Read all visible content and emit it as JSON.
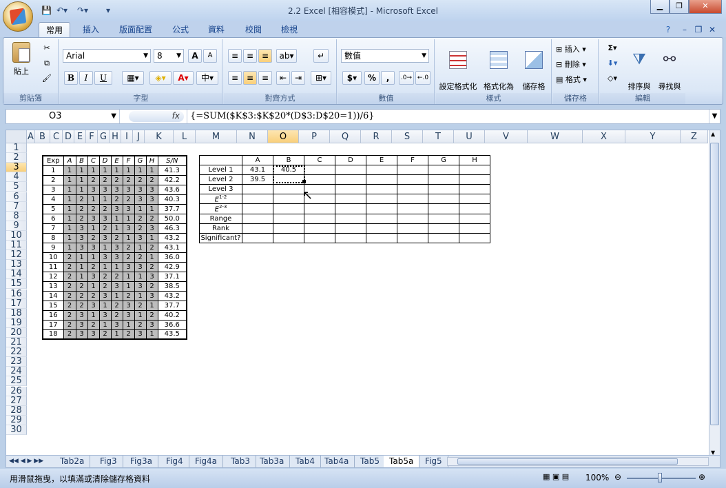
{
  "window": {
    "title": "2.2 Excel  [相容模式] - Microsoft Excel"
  },
  "ribbon_tabs": [
    "常用",
    "插入",
    "版面配置",
    "公式",
    "資料",
    "校閱",
    "檢視"
  ],
  "clipboard": {
    "paste": "貼上",
    "label": "剪貼簿"
  },
  "font": {
    "name": "Arial",
    "size": "8",
    "label": "字型",
    "bold": "B",
    "italic": "I",
    "underline": "U",
    "grow": "A",
    "shrink": "A",
    "color_char": "A"
  },
  "align": {
    "label": "對齊方式"
  },
  "number": {
    "format": "數值",
    "label": "數值",
    "currency": "$",
    "percent": "%",
    "comma": ","
  },
  "styles": {
    "cond": "設定格式化\n的條件",
    "table": "格式化為\n表格",
    "cell": "儲存格\n樣式",
    "label": "樣式"
  },
  "cells": {
    "insert": "插入",
    "delete": "刪除",
    "format": "格式",
    "label": "儲存格"
  },
  "editing": {
    "sort": "排序與\n篩選",
    "find": "尋找與\n選取",
    "label": "編輯",
    "sigma": "Σ"
  },
  "namebox": "O3",
  "fx": "fx",
  "formula": "{=SUM($K$3:$K$20*(D$3:D$20=1))/6}",
  "columns": [
    "A",
    "B",
    "C",
    "D",
    "E",
    "F",
    "G",
    "H",
    "I",
    "J",
    "K",
    "L",
    "M",
    "N",
    "O",
    "P",
    "Q",
    "R",
    "S",
    "T",
    "U",
    "V",
    "W",
    "X",
    "Y",
    "Z"
  ],
  "rows": [
    "1",
    "2",
    "3",
    "4",
    "5",
    "6",
    "7",
    "8",
    "9",
    "10",
    "11",
    "12",
    "13",
    "14",
    "15",
    "16",
    "17",
    "18",
    "19",
    "20",
    "21",
    "22",
    "23",
    "24",
    "25",
    "26",
    "27",
    "28",
    "29",
    "30"
  ],
  "table1": {
    "header": [
      "Exp",
      "A",
      "B",
      "C",
      "D",
      "E",
      "F",
      "G",
      "H",
      "S/N"
    ],
    "rows": [
      [
        "1",
        "1",
        "1",
        "1",
        "1",
        "1",
        "1",
        "1",
        "1",
        "41.3"
      ],
      [
        "2",
        "1",
        "1",
        "2",
        "2",
        "2",
        "2",
        "2",
        "2",
        "42.2"
      ],
      [
        "3",
        "1",
        "1",
        "3",
        "3",
        "3",
        "3",
        "3",
        "3",
        "43.6"
      ],
      [
        "4",
        "1",
        "2",
        "1",
        "1",
        "2",
        "2",
        "3",
        "3",
        "40.3"
      ],
      [
        "5",
        "1",
        "2",
        "2",
        "2",
        "3",
        "3",
        "1",
        "1",
        "37.7"
      ],
      [
        "6",
        "1",
        "2",
        "3",
        "3",
        "1",
        "1",
        "2",
        "2",
        "50.0"
      ],
      [
        "7",
        "1",
        "3",
        "1",
        "2",
        "1",
        "3",
        "2",
        "3",
        "46.3"
      ],
      [
        "8",
        "1",
        "3",
        "2",
        "3",
        "2",
        "1",
        "3",
        "1",
        "43.2"
      ],
      [
        "9",
        "1",
        "3",
        "3",
        "1",
        "3",
        "2",
        "1",
        "2",
        "43.1"
      ],
      [
        "10",
        "2",
        "1",
        "1",
        "3",
        "3",
        "2",
        "2",
        "1",
        "36.0"
      ],
      [
        "11",
        "2",
        "1",
        "2",
        "1",
        "1",
        "3",
        "3",
        "2",
        "42.9"
      ],
      [
        "12",
        "2",
        "1",
        "3",
        "2",
        "2",
        "1",
        "1",
        "3",
        "37.1"
      ],
      [
        "13",
        "2",
        "2",
        "1",
        "2",
        "3",
        "1",
        "3",
        "2",
        "38.5"
      ],
      [
        "14",
        "2",
        "2",
        "2",
        "3",
        "1",
        "2",
        "1",
        "3",
        "43.2"
      ],
      [
        "15",
        "2",
        "2",
        "3",
        "1",
        "2",
        "3",
        "2",
        "1",
        "37.7"
      ],
      [
        "16",
        "2",
        "3",
        "1",
        "3",
        "2",
        "3",
        "1",
        "2",
        "40.2"
      ],
      [
        "17",
        "2",
        "3",
        "2",
        "1",
        "3",
        "1",
        "2",
        "3",
        "36.6"
      ],
      [
        "18",
        "2",
        "3",
        "3",
        "2",
        "1",
        "2",
        "3",
        "1",
        "43.5"
      ]
    ]
  },
  "table2": {
    "header": [
      "",
      "A",
      "B",
      "C",
      "D",
      "E",
      "F",
      "G",
      "H"
    ],
    "rows": [
      [
        "Level 1",
        "43.1",
        "40.5",
        "",
        "",
        "",
        "",
        "",
        ""
      ],
      [
        "Level 2",
        "39.5",
        "",
        "",
        "",
        "",
        "",
        "",
        ""
      ],
      [
        "Level 3",
        "",
        "",
        "",
        "",
        "",
        "",
        "",
        ""
      ],
      [
        "E1-2",
        "",
        "",
        "",
        "",
        "",
        "",
        "",
        ""
      ],
      [
        "E2-3",
        "",
        "",
        "",
        "",
        "",
        "",
        "",
        ""
      ],
      [
        "Range",
        "",
        "",
        "",
        "",
        "",
        "",
        "",
        ""
      ],
      [
        "Rank",
        "",
        "",
        "",
        "",
        "",
        "",
        "",
        ""
      ],
      [
        "Significant?",
        "",
        "",
        "",
        "",
        "",
        "",
        "",
        ""
      ]
    ]
  },
  "sheet_tabs": [
    "Tab2a",
    "Fig3",
    "Fig3a",
    "Fig4",
    "Fig4a",
    "Tab3",
    "Tab3a",
    "Tab4",
    "Tab4a",
    "Tab5",
    "Tab5a",
    "Fig5"
  ],
  "active_sheet": "Tab5a",
  "status": {
    "text": "用滑鼠拖曳，以填滿或清除儲存格資料",
    "zoom": "100%"
  }
}
